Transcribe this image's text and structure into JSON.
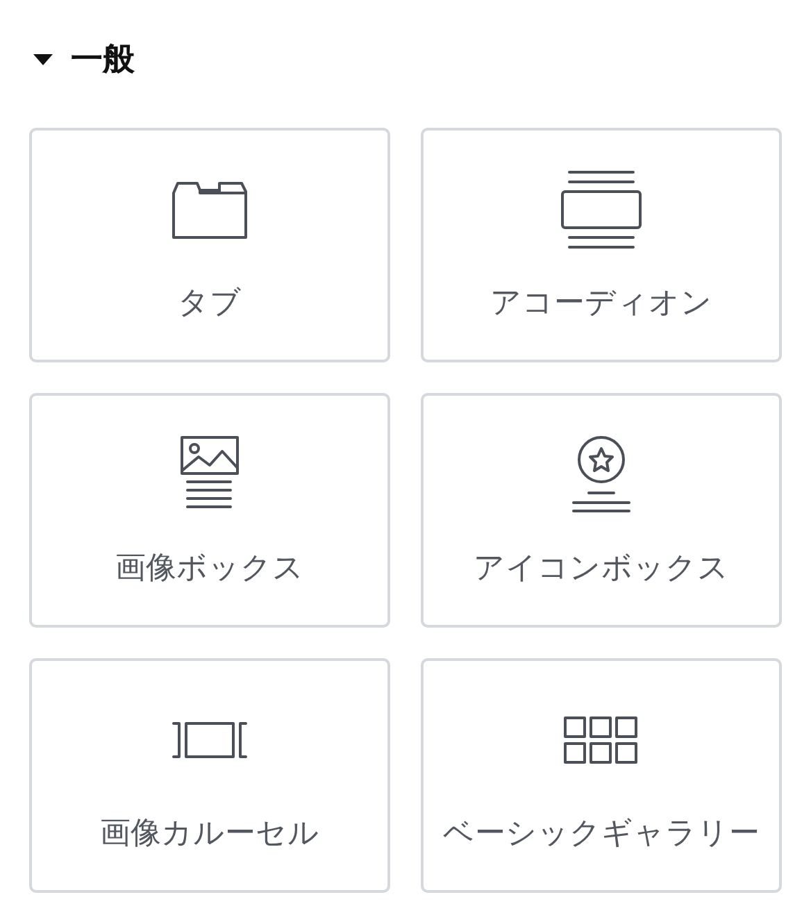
{
  "section": {
    "title": "一般",
    "expanded": true
  },
  "widgets": [
    {
      "kind": "tabs",
      "label": "タブ"
    },
    {
      "kind": "accordion",
      "label": "アコーディオン"
    },
    {
      "kind": "image-box",
      "label": "画像ボックス"
    },
    {
      "kind": "icon-box",
      "label": "アイコンボックス"
    },
    {
      "kind": "carousel",
      "label": "画像カルーセル"
    },
    {
      "kind": "gallery",
      "label": "ベーシックギャラリー"
    }
  ]
}
